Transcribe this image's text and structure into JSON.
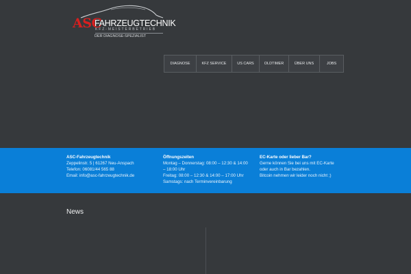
{
  "logo": {
    "brand_mark": "ASC",
    "name": "FAHRZEUGTECHNIK",
    "subtitle": "KFZ-MEISTERBETRIEB",
    "tagline": "DER DIAGNOSE-SPEZIALIST"
  },
  "nav": {
    "items": [
      {
        "label": "DIAGNOSE"
      },
      {
        "label": "KFZ SERVICE"
      },
      {
        "label": "US CARS"
      },
      {
        "label": "OLDTIMER"
      },
      {
        "label": "ÜBER UNS"
      },
      {
        "label": "JOBS"
      }
    ]
  },
  "footer_band": {
    "contact": {
      "title": "ASC-Fahrzeugtechnik",
      "line1": "Zeppelinstr. 5 | 61267 Neu-Anspach",
      "line2": "Telefon: 06081/44 565 88",
      "line3": "Email: info@asc-fahrzeugtechnik.de"
    },
    "hours": {
      "title": "Öffnungszeiten",
      "line1": "Montag – Donnerstag: 08:00 – 12:30 & 14:00",
      "line2": "– 18:00 Uhr",
      "line3": "Freitag: 08:00 – 12:30 & 14:00 – 17:00 Uhr",
      "line4": "Samstags: nach Terminvereinbarung"
    },
    "payment": {
      "title": "EC-Karte oder lieber Bar?",
      "line1": "Gerne können Sie bei uns mit EC-Karte",
      "line2": "oder auch in Bar bezahlen.",
      "line3": "Bitcoin nehmen wir leider noch nicht ;)"
    }
  },
  "news": {
    "title": "News"
  },
  "colors": {
    "background": "#36393c",
    "band": "#0a7fd8",
    "brand_red": "#d81f1f"
  }
}
